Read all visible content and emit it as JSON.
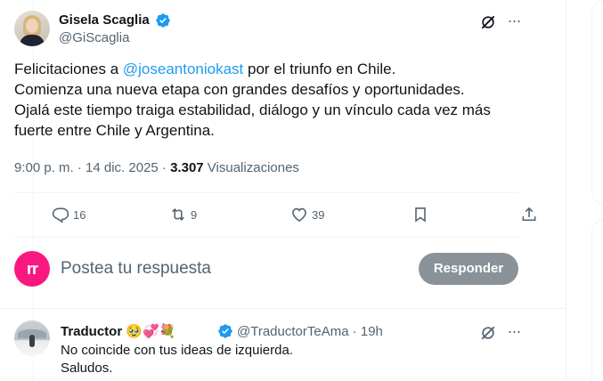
{
  "tweet": {
    "author_name": "Gisela Scaglia",
    "handle": "@GiScaglia",
    "text_prefix": "Felicitaciones a ",
    "mention": "@joseantoniokast",
    "text_suffix": " por el triunfo en Chile.",
    "line2": "Comienza una nueva etapa con grandes desafíos y oportunidades.",
    "line3": "Ojalá este tiempo traiga estabilidad, diálogo y un vínculo cada vez más",
    "line4": "fuerte entre Chile y Argentina.",
    "timestamp": "9:00 p. m. · 14 dic. 2025 · ",
    "views_count": "3.307",
    "views_label": " Visualizaciones",
    "replies": "16",
    "reposts": "9",
    "likes": "39",
    "more_glyph": "···"
  },
  "reply_composer": {
    "avatar_text": "rr",
    "placeholder": "Postea tu respuesta",
    "button_label": "Responder"
  },
  "reply_tweet": {
    "author_name": "Traductor",
    "name_emojis": "🥹💞💐",
    "handle_time": "@TraductorTeAma · 19h",
    "line1": "No coincide con tus ideas de izquierda.",
    "line2": "Saludos.",
    "more_glyph": "···"
  },
  "colors": {
    "accent": "#1d9bf0",
    "text_primary": "#0f1419",
    "text_secondary": "#536471",
    "avatar_pink": "#f91880",
    "button_disabled": "#8b9297"
  },
  "icons": {
    "verified": "verified-badge-icon",
    "grok": "grok-icon",
    "more": "more-icon",
    "reply": "reply-icon",
    "repost": "repost-icon",
    "like": "heart-icon",
    "bookmark": "bookmark-icon",
    "share": "share-icon"
  }
}
